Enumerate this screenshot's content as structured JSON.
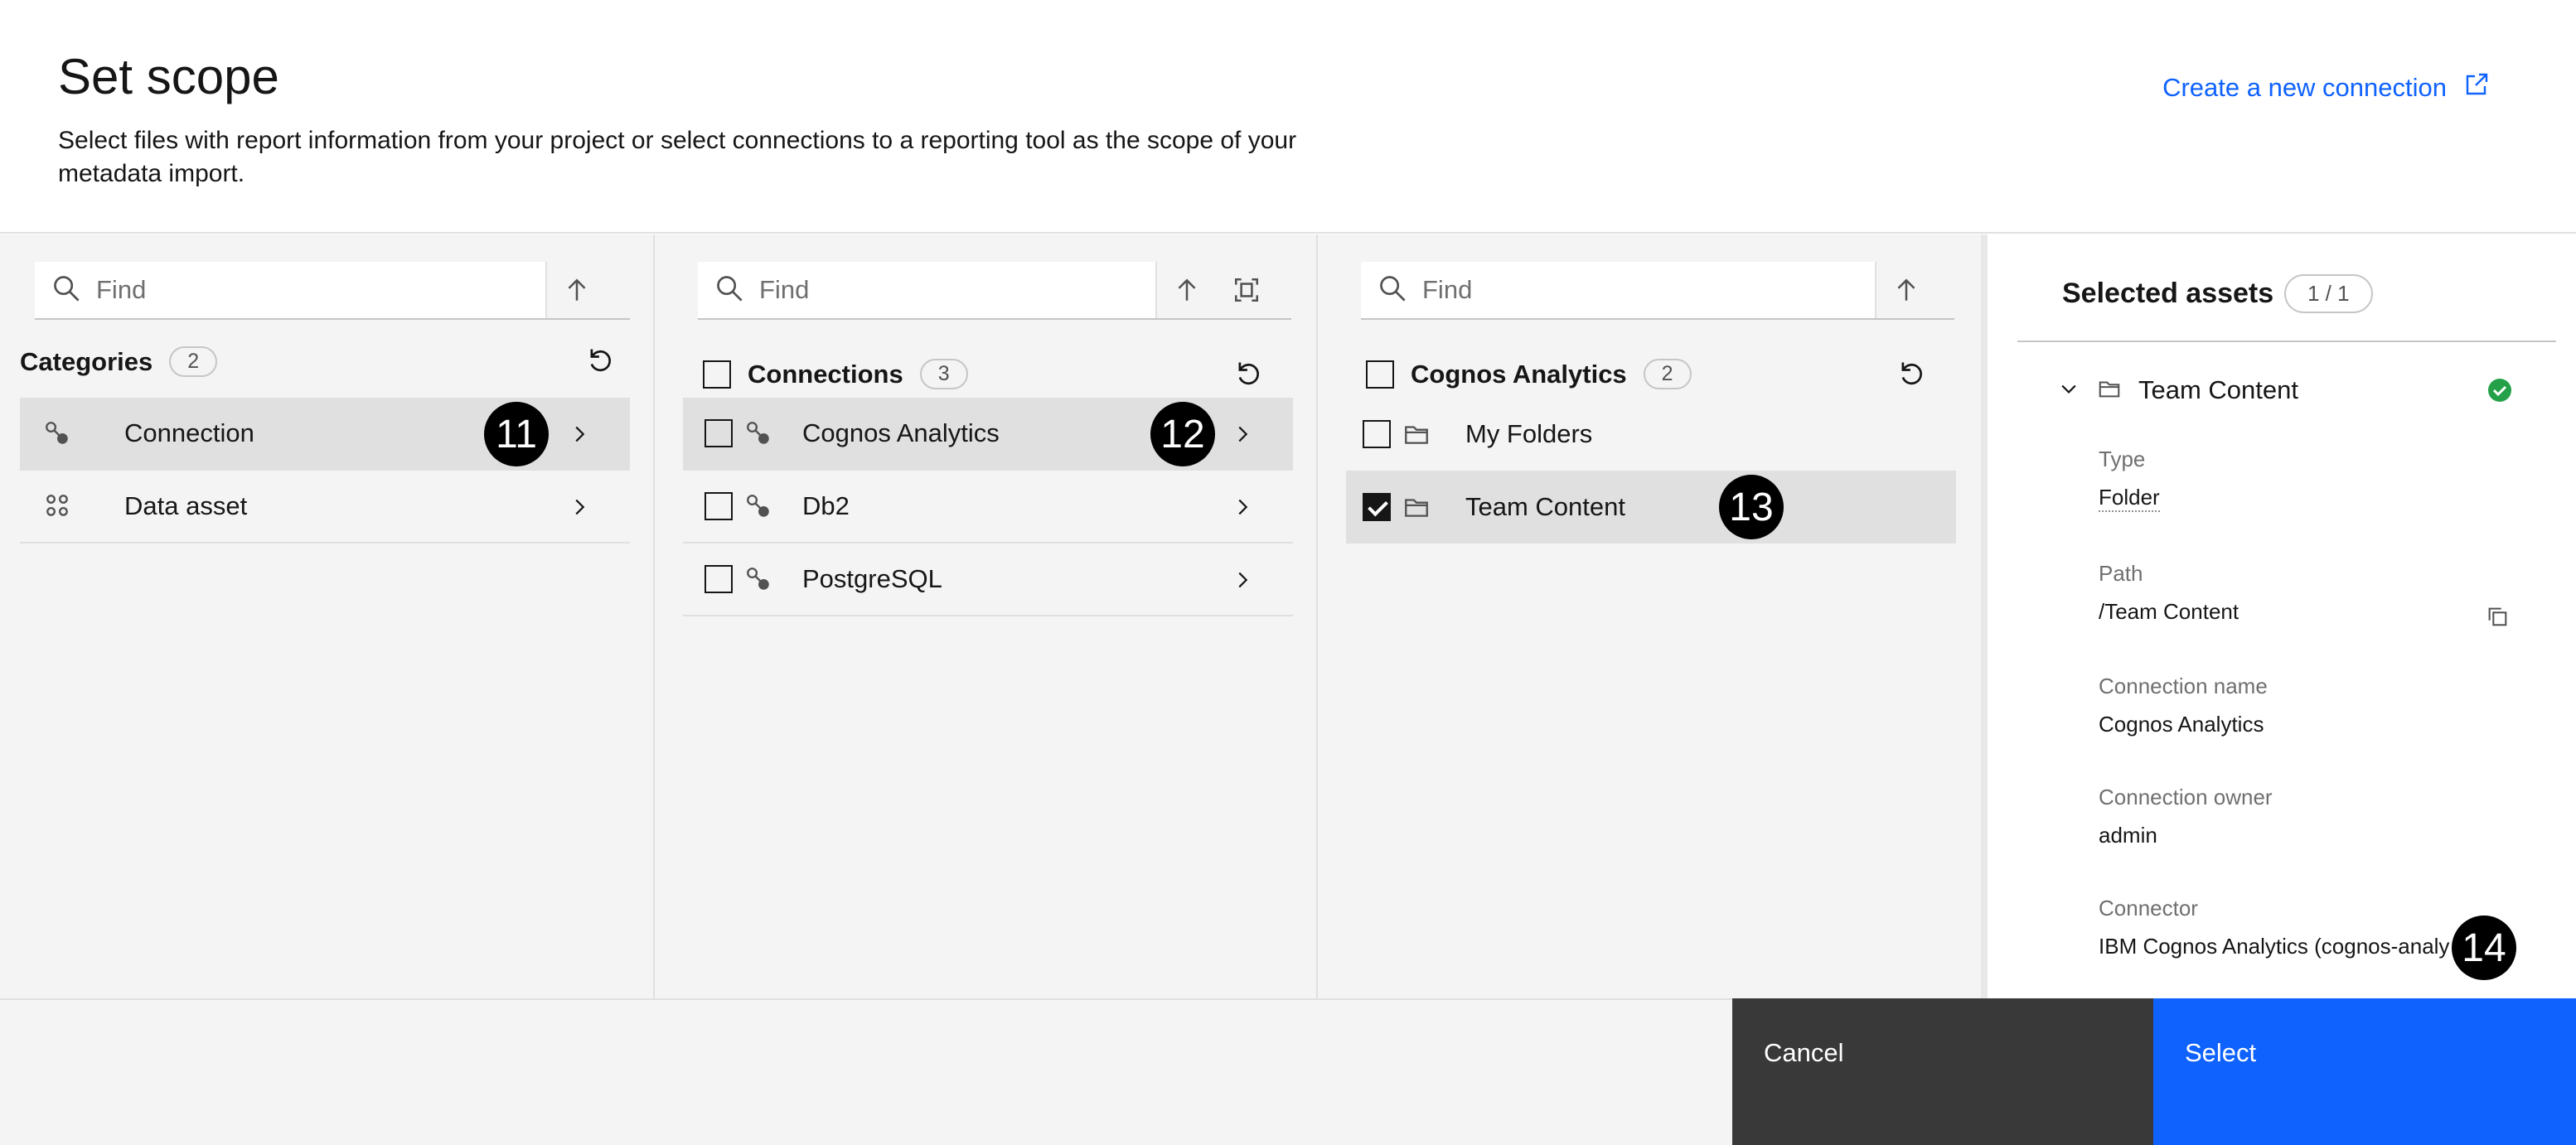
{
  "header": {
    "title": "Set scope",
    "description": "Select files with report information from your project or select connections to a reporting tool as the scope of your metadata import.",
    "create_link": "Create a new connection"
  },
  "col1": {
    "search_placeholder": "Find",
    "heading": "Categories",
    "count": "2",
    "items": [
      {
        "label": "Connection",
        "icon": "connection-icon",
        "selected": true
      },
      {
        "label": "Data asset",
        "icon": "data-asset-icon",
        "selected": false
      }
    ]
  },
  "col2": {
    "search_placeholder": "Find",
    "heading": "Connections",
    "count": "3",
    "items": [
      {
        "label": "Cognos Analytics",
        "selected": true
      },
      {
        "label": "Db2",
        "selected": false
      },
      {
        "label": "PostgreSQL",
        "selected": false
      }
    ]
  },
  "col3": {
    "search_placeholder": "Find",
    "heading": "Cognos Analytics",
    "count": "2",
    "items": [
      {
        "label": "My Folders",
        "checked": false
      },
      {
        "label": "Team Content",
        "checked": true
      }
    ]
  },
  "detail": {
    "title": "Selected assets",
    "count": "1 / 1",
    "item_name": "Team Content",
    "fields": {
      "type_label": "Type",
      "type_value": "Folder",
      "path_label": "Path",
      "path_value": "/Team Content",
      "conn_name_label": "Connection name",
      "conn_name_value": "Cognos Analytics",
      "conn_owner_label": "Connection owner",
      "conn_owner_value": "admin",
      "connector_label": "Connector",
      "connector_value": "IBM Cognos Analytics (cognos-analy"
    }
  },
  "markers": {
    "m11": "11",
    "m12": "12",
    "m13": "13",
    "m14": "14"
  },
  "footer": {
    "cancel": "Cancel",
    "select": "Select"
  },
  "colors": {
    "accent": "#0f62fe",
    "success": "#24a148",
    "dark": "#393939"
  }
}
